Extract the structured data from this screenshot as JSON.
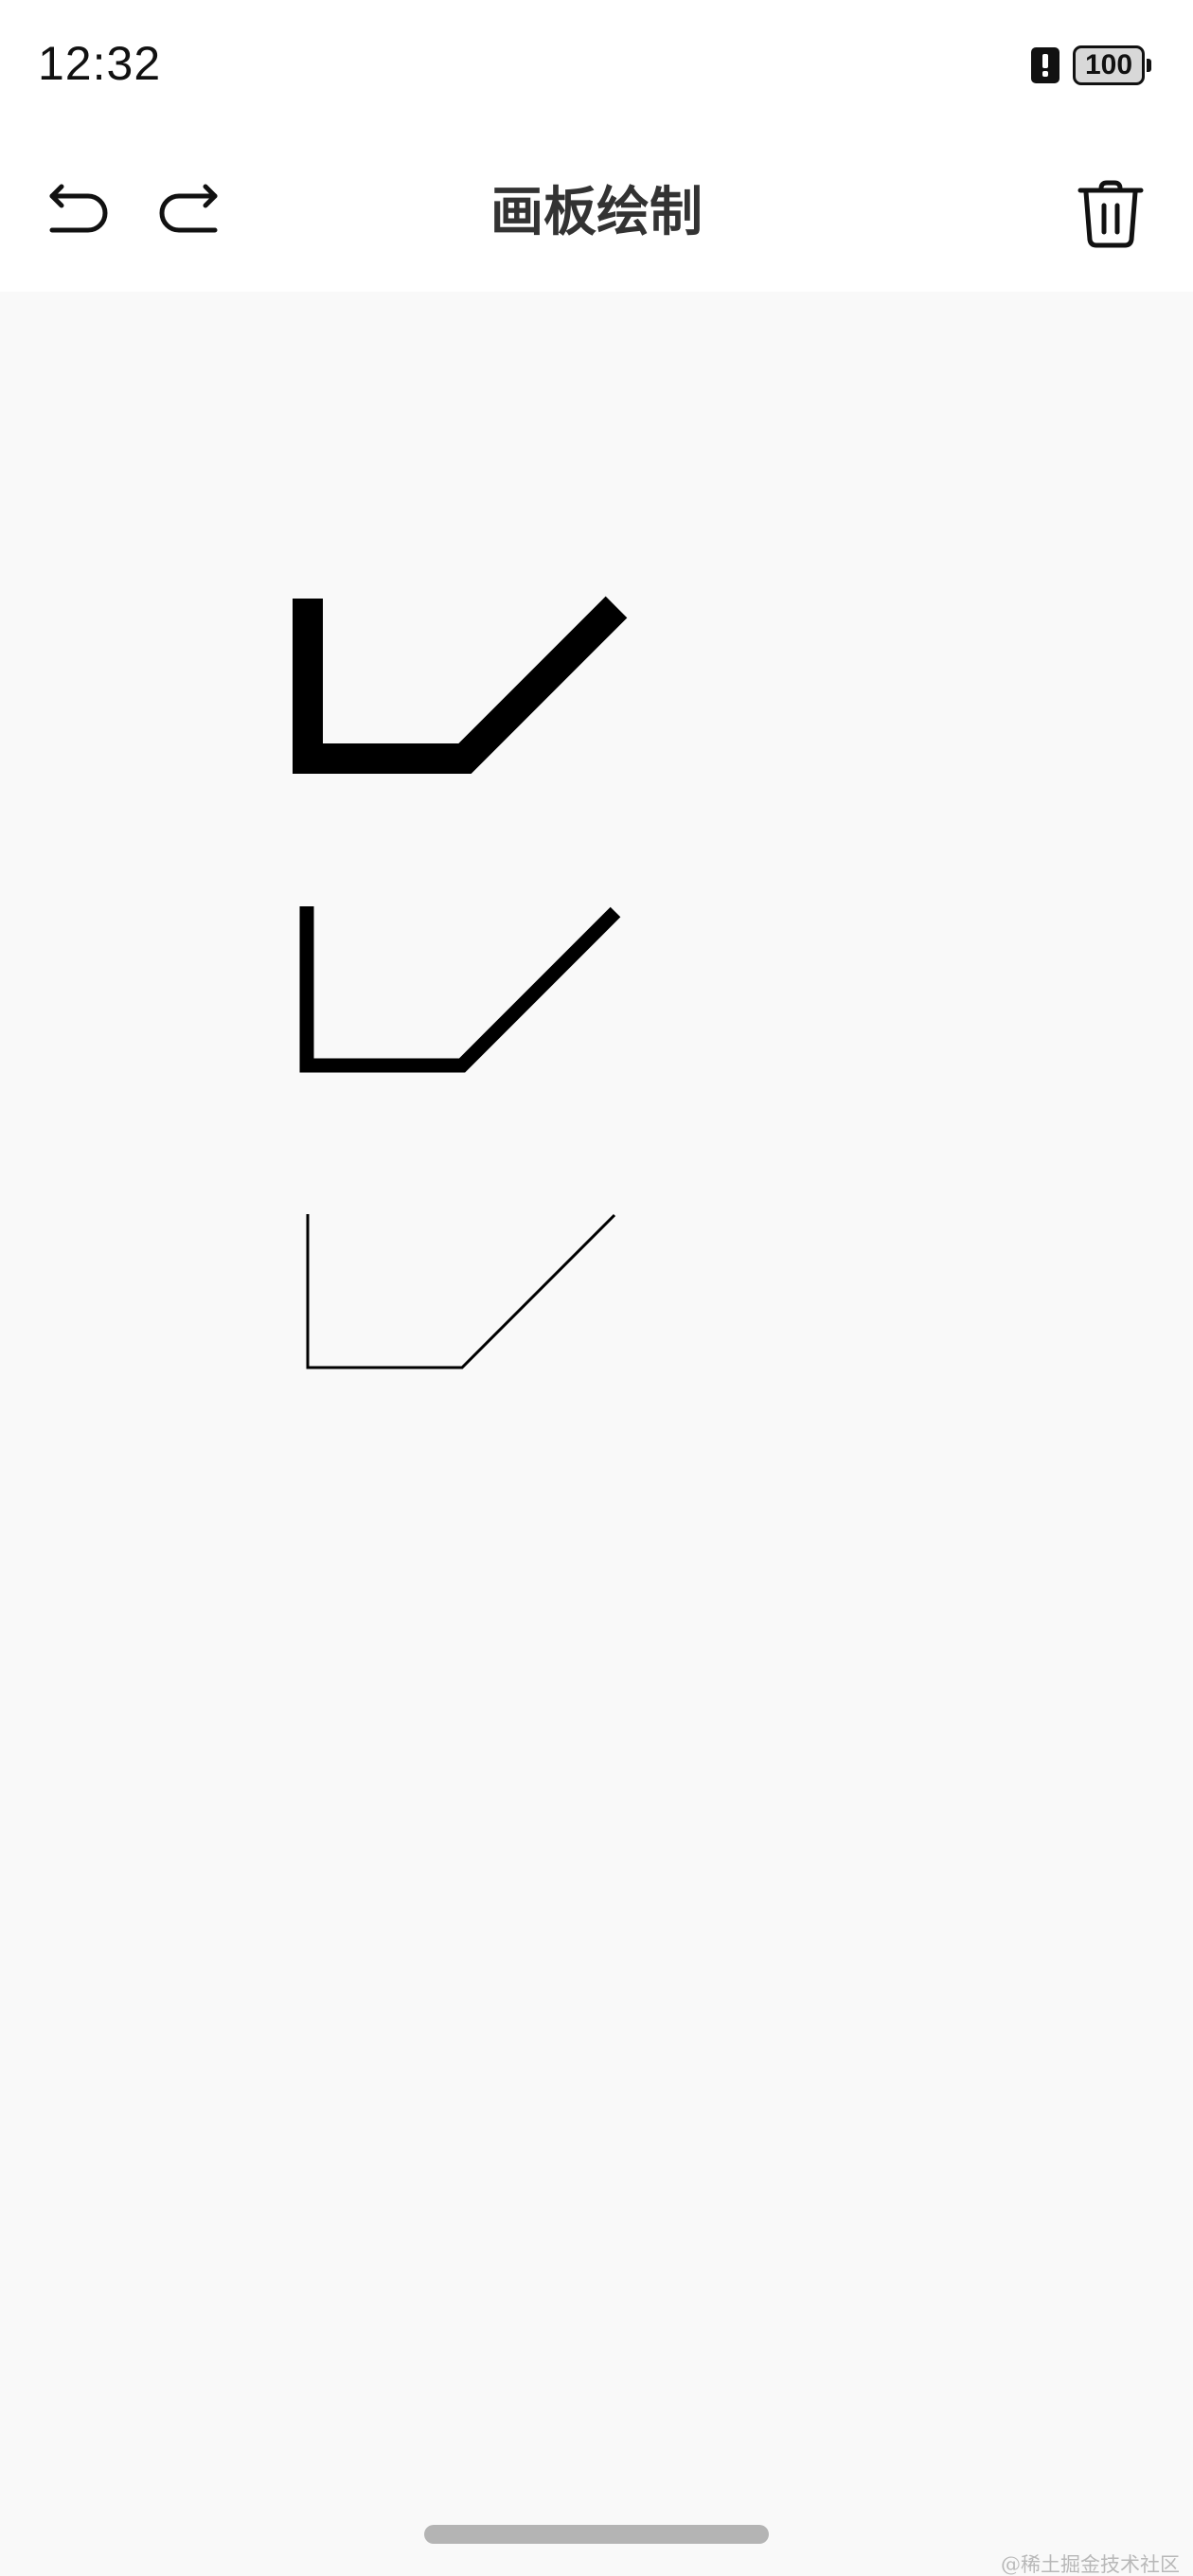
{
  "status_bar": {
    "time": "12:32",
    "alert_icon": "alert-icon",
    "battery_level": "100"
  },
  "toolbar": {
    "title": "画板绘制",
    "undo_icon": "undo-icon",
    "redo_icon": "redo-icon",
    "delete_icon": "trash-icon"
  },
  "canvas": {
    "background_color": "#f9f9f9",
    "stroke_color": "#000000",
    "strokes": [
      {
        "name": "stroke-thick"
      },
      {
        "name": "stroke-medium"
      },
      {
        "name": "stroke-thin"
      }
    ]
  },
  "watermark": "@稀土掘金技术社区"
}
